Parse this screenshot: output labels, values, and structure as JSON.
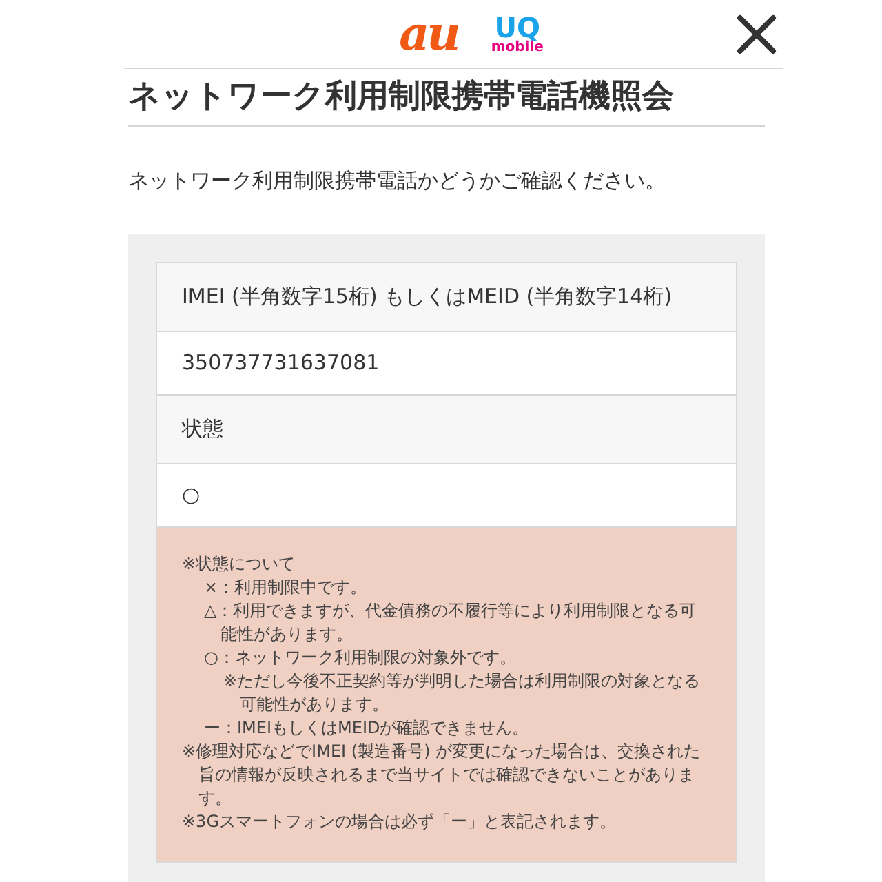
{
  "header": {
    "logo_au": "au",
    "logo_uq": "UQ",
    "logo_mobile": "mobile"
  },
  "title": "ネットワーク利用制限携帯電話機照会",
  "intro": "ネットワーク利用制限携帯電話かどうかご確認ください。",
  "result_table": [
    {
      "label": "IMEI (半角数字15桁) もしくはMEID (半角数字14桁)",
      "value": "350737731637081"
    },
    {
      "label": "状態",
      "value": "○"
    }
  ],
  "notes": [
    {
      "text": "※状態について",
      "children": [
        {
          "text": "×：利用制限中です。"
        },
        {
          "text": "△：利用できますが、代金債務の不履行等により利用制限となる可能性があります。"
        },
        {
          "text": "○：ネットワーク利用制限の対象外です。",
          "children": [
            {
              "text": "※ただし今後不正契約等が判明した場合は利用制限の対象となる可能性があります。"
            }
          ]
        },
        {
          "text": "ー：IMEIもしくはMEIDが確認できません。"
        }
      ]
    },
    {
      "text": "※修理対応などでIMEI (製造番号) が変更になった場合は、交換された旨の情報が反映されるまで当サイトでは確認できないことがあります。"
    },
    {
      "text": "※3Gスマートフォンの場合は必ず「ー」と表記されます。"
    }
  ]
}
